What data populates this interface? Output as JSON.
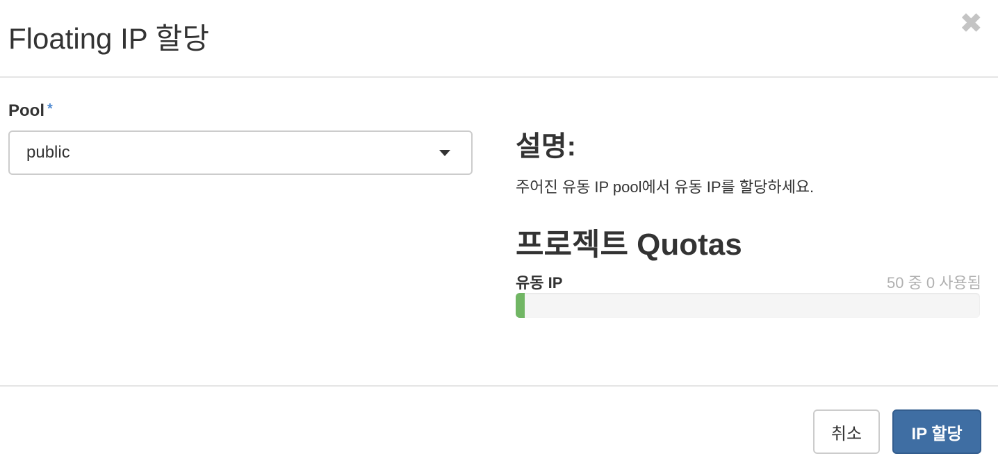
{
  "header": {
    "title": "Floating IP 할당",
    "close_icon": "close-icon"
  },
  "form": {
    "pool_label": "Pool",
    "required_mark": "*",
    "pool_value": "public"
  },
  "description": {
    "heading": "설명:",
    "text": "주어진 유동 IP pool에서 유동 IP를 할당하세요."
  },
  "quotas": {
    "heading": "프로젝트 Quotas",
    "label": "유동 IP",
    "usage_text": "50 중 0 사용됨",
    "used": 0,
    "limit": 50,
    "bar_color": "#71b664"
  },
  "footer": {
    "cancel_label": "취소",
    "submit_label": "IP 할당",
    "submit_color": "#3f6ea3"
  }
}
